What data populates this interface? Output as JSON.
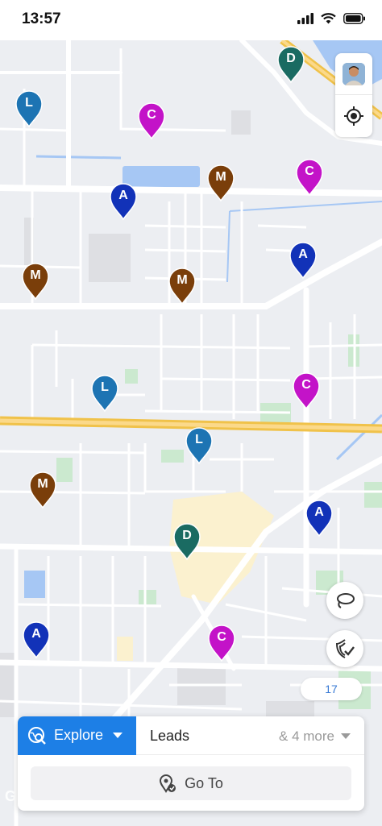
{
  "status_bar": {
    "time": "13:57"
  },
  "map": {
    "pins": [
      {
        "letter": "D",
        "type": "distributor",
        "color": "#1a6b62"
      },
      {
        "letter": "L",
        "type": "lead",
        "color": "#1d74b3"
      },
      {
        "letter": "C",
        "type": "customer",
        "color": "#c313c8"
      },
      {
        "letter": "M",
        "type": "merchant",
        "color": "#7a3e0a"
      },
      {
        "letter": "C",
        "type": "customer",
        "color": "#c313c8"
      },
      {
        "letter": "A",
        "type": "agent",
        "color": "#1232b8"
      },
      {
        "letter": "A",
        "type": "agent",
        "color": "#1232b8"
      },
      {
        "letter": "M",
        "type": "merchant",
        "color": "#7a3e0a"
      },
      {
        "letter": "M",
        "type": "merchant",
        "color": "#7a3e0a"
      },
      {
        "letter": "L",
        "type": "lead",
        "color": "#1d74b3"
      },
      {
        "letter": "C",
        "type": "customer",
        "color": "#c313c8"
      },
      {
        "letter": "L",
        "type": "lead",
        "color": "#1d74b3"
      },
      {
        "letter": "M",
        "type": "merchant",
        "color": "#7a3e0a"
      },
      {
        "letter": "A",
        "type": "agent",
        "color": "#1232b8"
      },
      {
        "letter": "D",
        "type": "distributor",
        "color": "#1a6b62"
      },
      {
        "letter": "A",
        "type": "agent",
        "color": "#1232b8"
      },
      {
        "letter": "C",
        "type": "customer",
        "color": "#c313c8"
      }
    ],
    "count_badge": "17",
    "google_mark": "G"
  },
  "controls": {
    "avatar_icon": "user-avatar",
    "locate_icon": "crosshair-icon",
    "lasso_icon": "lasso-icon",
    "verified_icon": "verified-shield-icon"
  },
  "bottom_panel": {
    "explore_label": "Explore",
    "leads_label": "Leads",
    "more_label": "& 4 more",
    "goto_label": "Go To"
  },
  "colors": {
    "accent": "#1d7fe6",
    "map_background": "#eceef2",
    "highway": "#f3c563"
  }
}
